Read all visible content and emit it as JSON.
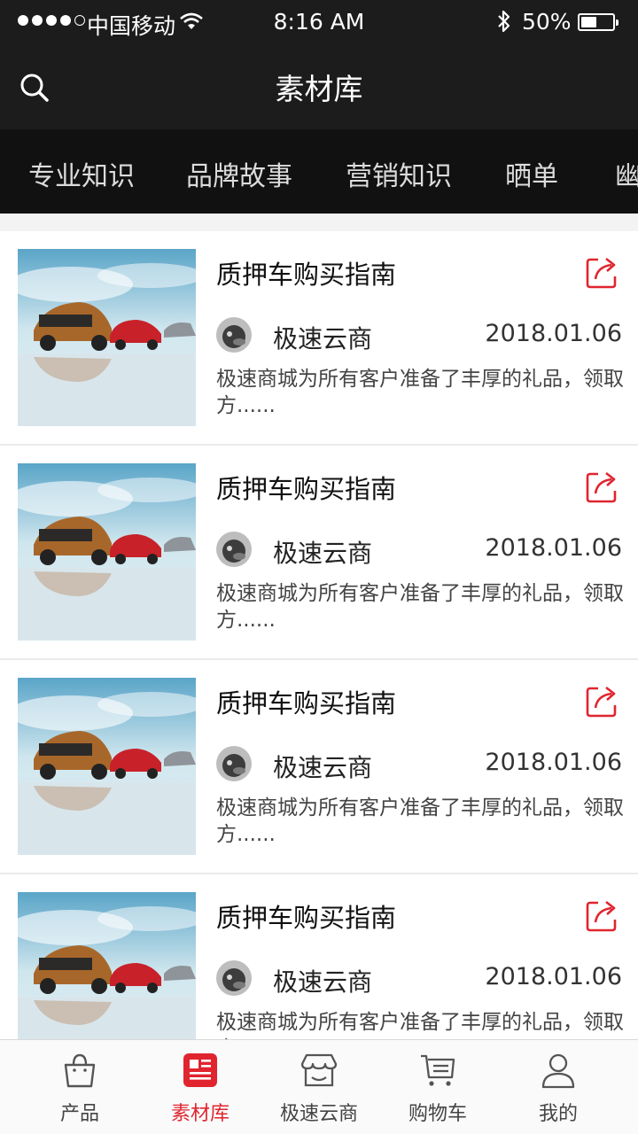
{
  "status_bar": {
    "carrier": "中国移动",
    "time": "8:16 AM",
    "battery": "50%",
    "battery_level": 0.5
  },
  "header": {
    "title": "素材库"
  },
  "tabs": [
    {
      "label": "专业知识",
      "active": true
    },
    {
      "label": "品牌故事",
      "active": false
    },
    {
      "label": "营销知识",
      "active": false
    },
    {
      "label": "晒单",
      "active": false
    },
    {
      "label": "幽",
      "active": false
    }
  ],
  "articles": [
    {
      "title": "质押车购买指南",
      "author": "极速云商",
      "date": "2018.01.06",
      "summary": "极速商城为所有客户准备了丰厚的礼品，领取方......"
    },
    {
      "title": "质押车购买指南",
      "author": "极速云商",
      "date": "2018.01.06",
      "summary": "极速商城为所有客户准备了丰厚的礼品，领取方......"
    },
    {
      "title": "质押车购买指南",
      "author": "极速云商",
      "date": "2018.01.06",
      "summary": "极速商城为所有客户准备了丰厚的礼品，领取方......"
    },
    {
      "title": "质押车购买指南",
      "author": "极速云商",
      "date": "2018.01.06",
      "summary": "极速商城为所有客户准备了丰厚的礼品，领取方......"
    }
  ],
  "bottom_nav": [
    {
      "label": "产品",
      "icon": "shopping-bag-icon",
      "active": false
    },
    {
      "label": "素材库",
      "icon": "article-icon",
      "active": true
    },
    {
      "label": "极速云商",
      "icon": "store-icon",
      "active": false
    },
    {
      "label": "购物车",
      "icon": "cart-icon",
      "active": false
    },
    {
      "label": "我的",
      "icon": "user-icon",
      "active": false
    }
  ],
  "colors": {
    "accent": "#e0252f",
    "header_bg": "#1c1c1c",
    "tabs_bg": "#111111"
  }
}
